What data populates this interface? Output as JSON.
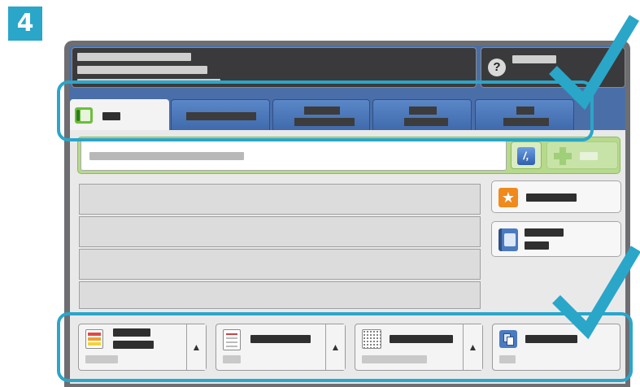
{
  "step": {
    "number": "4"
  },
  "colors": {
    "highlight": "#2aa6c9",
    "checkmark": "#2aa6c9",
    "tab_inactive": "#4a7bc0",
    "search_bar": "#b6d98c",
    "favorite_icon": "#f08a1c",
    "address_book_icon": "#4a7bc0"
  },
  "header": {
    "left_lines": [
      "",
      "",
      ""
    ],
    "help_icon": "help-icon",
    "right_label": ""
  },
  "tabs": [
    {
      "label": "",
      "icon": "fax-icon",
      "active": true
    },
    {
      "label": "",
      "active": false
    },
    {
      "label": "",
      "active": false
    },
    {
      "label": "",
      "active": false
    },
    {
      "label": "",
      "active": false
    }
  ],
  "search": {
    "placeholder": "",
    "value": "",
    "dial_characters_icon": "dial-characters-icon",
    "add_icon": "plus-icon",
    "add_label": ""
  },
  "recipient_rows": [
    "",
    "",
    "",
    ""
  ],
  "side_buttons": [
    {
      "label": "",
      "icon": "star-icon"
    },
    {
      "label": "",
      "icon": "address-book-icon"
    }
  ],
  "features": [
    {
      "label": "",
      "value": "",
      "icon": "document-color-icon"
    },
    {
      "label": "",
      "value": "",
      "icon": "document-icon"
    },
    {
      "label": "",
      "value": "",
      "icon": "resolution-grid-icon"
    },
    {
      "label": "",
      "value": "",
      "icon": "copies-icon"
    }
  ],
  "annotations": {
    "top_check": "checkmark-icon",
    "bottom_check": "checkmark-icon"
  }
}
